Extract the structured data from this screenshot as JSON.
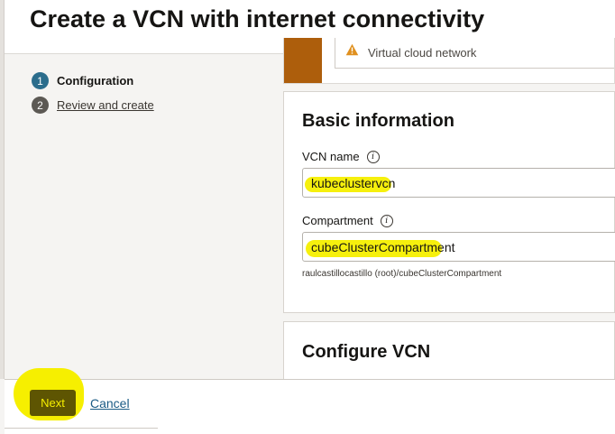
{
  "header": {
    "title": "Create a VCN with internet connectivity"
  },
  "steps": [
    {
      "number": "1",
      "label": "Configuration"
    },
    {
      "number": "2",
      "label": "Review and create"
    }
  ],
  "banner": {
    "text": "Virtual cloud network"
  },
  "basic_info": {
    "title": "Basic information",
    "vcn_name": {
      "label": "VCN name",
      "value": "kubeclustervcn"
    },
    "compartment": {
      "label": "Compartment",
      "value": "cubeClusterCompartment",
      "hint": "raulcastillocastillo (root)/cubeClusterCompartment"
    }
  },
  "configure_vcn": {
    "title": "Configure VCN"
  },
  "footer": {
    "next_label": "Next",
    "cancel_label": "Cancel"
  },
  "icons": {
    "info": "i",
    "warning": "warning-icon"
  },
  "colors": {
    "highlight": "#f6ef00",
    "banner_accent": "#ad5e0c",
    "step_active": "#2b6d8c",
    "link": "#1a5b85"
  }
}
